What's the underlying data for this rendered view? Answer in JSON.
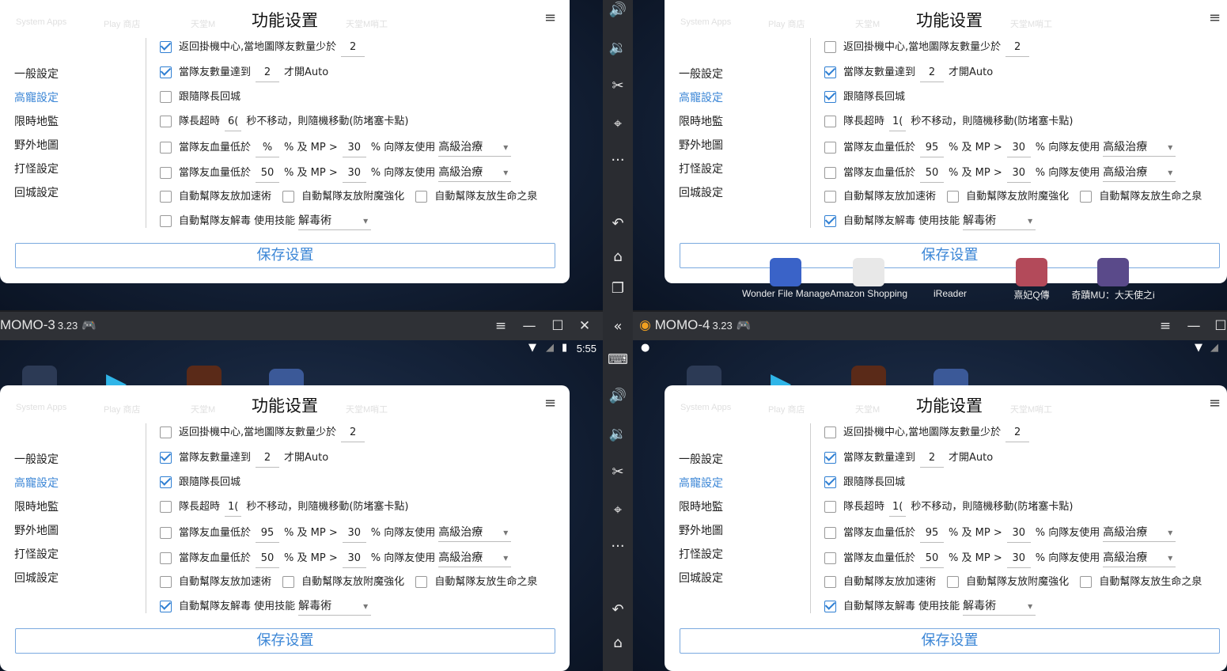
{
  "colors": {
    "accent": "#3b86d6",
    "titlebar": "#2f3136",
    "panel_bg": "#ffffff",
    "check": "#2f7fd3"
  },
  "windows": {
    "bl": {
      "app": "MOMO-3",
      "version": "3.23",
      "time": "5:55"
    },
    "br": {
      "app": "MOMO-4",
      "version": "3.23"
    }
  },
  "desktop": {
    "icons": [
      "System Apps",
      "Play 商店",
      "天堂M",
      "",
      "天堂M哨工"
    ]
  },
  "dock": {
    "items": [
      "Wonder File Manage",
      "Amazon Shopping",
      "iReader",
      "熹妃Q傳",
      "奇蹟MU：大天使之i"
    ]
  },
  "panel": {
    "title": "功能设置",
    "save_label": "保存设置",
    "nav": [
      "一般設定",
      "高寵設定",
      "限時地監",
      "野外地圖",
      "打怪設定",
      "回城設定"
    ],
    "active_nav": 1,
    "text": {
      "return_center": "返回掛機中心,當地圖隊友數量少於",
      "team_count": "當隊友數量達到",
      "auto_suffix": "才開Auto",
      "follow": "跟隨隊長回城",
      "leader_timeout": "隊長超時",
      "leader_suffix": "秒不移动，則隨機移動(防堵塞卡點)",
      "hp_low": "當隊友血量低於",
      "pct_mp": "% 及 MP >",
      "pct_use": "% 向隊友使用",
      "haste": "自動幫隊友放加速術",
      "magic": "自動幫隊友放附魔強化",
      "fountain": "自動幫隊友放生命之泉",
      "poison": "自動幫隊友解毒",
      "use_skill": "使用技能"
    }
  },
  "panels": [
    {
      "id": "tl",
      "return_checked": true,
      "return_count": "2",
      "team_checked": true,
      "team_count": "2",
      "follow_checked": false,
      "leader_checked": false,
      "leader_secs": "6(",
      "hp1_checked": false,
      "hp1": "%",
      "mp1": "30",
      "skill1": "高級治療",
      "hp2_checked": false,
      "hp2": "50",
      "mp2": "30",
      "skill2": "高級治療",
      "haste_checked": false,
      "magic_checked": false,
      "fountain_checked": false,
      "poison_checked": false,
      "poison_skill": "解毒術"
    },
    {
      "id": "tr",
      "return_checked": false,
      "return_count": "2",
      "team_checked": true,
      "team_count": "2",
      "follow_checked": true,
      "leader_checked": false,
      "leader_secs": "1(",
      "hp1_checked": false,
      "hp1": "95",
      "mp1": "30",
      "skill1": "高級治療",
      "hp2_checked": false,
      "hp2": "50",
      "mp2": "30",
      "skill2": "高級治療",
      "haste_checked": false,
      "magic_checked": false,
      "fountain_checked": false,
      "poison_checked": true,
      "poison_skill": "解毒術"
    },
    {
      "id": "bl",
      "return_checked": false,
      "return_count": "2",
      "team_checked": true,
      "team_count": "2",
      "follow_checked": true,
      "leader_checked": false,
      "leader_secs": "1(",
      "hp1_checked": false,
      "hp1": "95",
      "mp1": "30",
      "skill1": "高級治療",
      "hp2_checked": false,
      "hp2": "50",
      "mp2": "30",
      "skill2": "高級治療",
      "haste_checked": false,
      "magic_checked": false,
      "fountain_checked": false,
      "poison_checked": true,
      "poison_skill": "解毒術"
    },
    {
      "id": "br",
      "return_checked": false,
      "return_count": "2",
      "team_checked": true,
      "team_count": "2",
      "follow_checked": true,
      "leader_checked": false,
      "leader_secs": "1(",
      "hp1_checked": false,
      "hp1": "95",
      "mp1": "30",
      "skill1": "高級治療",
      "hp2_checked": false,
      "hp2": "50",
      "mp2": "30",
      "skill2": "高級治療",
      "haste_checked": false,
      "magic_checked": false,
      "fountain_checked": false,
      "poison_checked": true,
      "poison_skill": "解毒術"
    }
  ]
}
